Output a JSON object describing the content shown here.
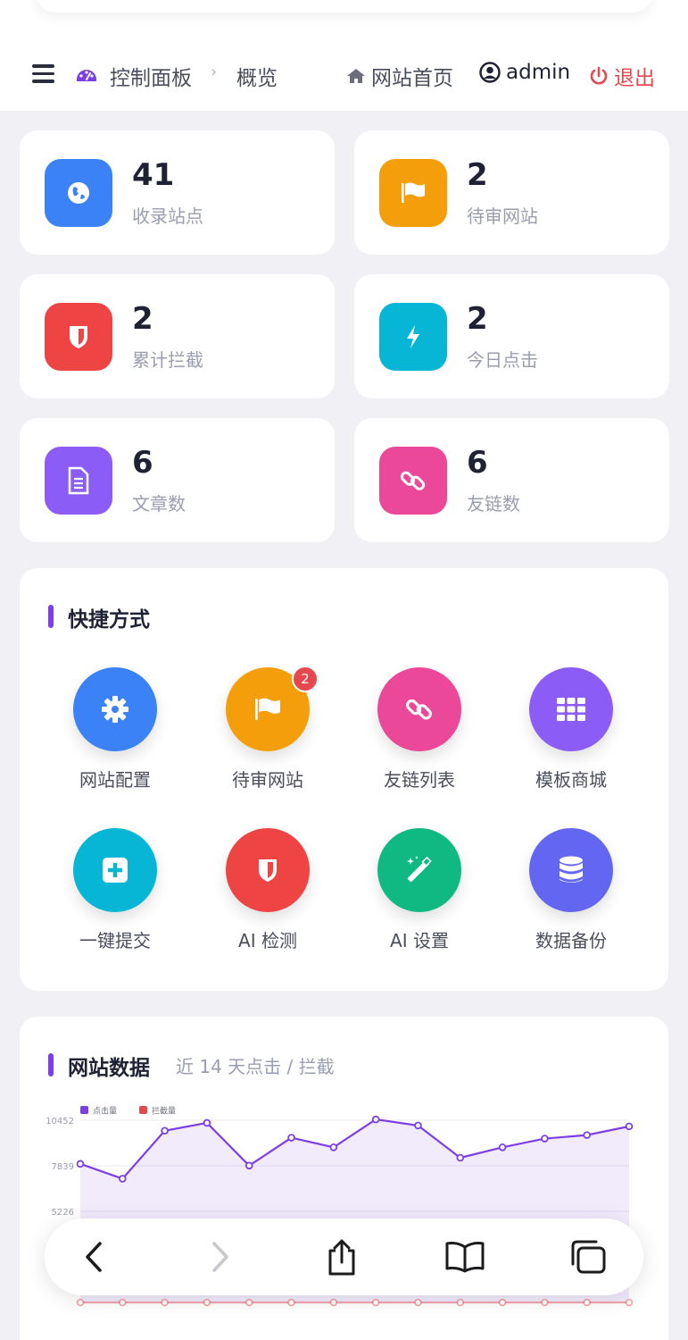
{
  "header": {
    "breadcrumb_title": "控制面板",
    "breadcrumb_sep": "›",
    "breadcrumb_current": "概览",
    "home_label": "网站首页",
    "user_label": "admin",
    "logout_label": "退出"
  },
  "stats": [
    {
      "value": "41",
      "label": "收录站点",
      "color": "#3b82f6",
      "icon": "globe-icon"
    },
    {
      "value": "2",
      "label": "待审网站",
      "color": "#f59e0b",
      "icon": "flag-icon"
    },
    {
      "value": "2",
      "label": "累计拦截",
      "color": "#ef4444",
      "icon": "shield-icon"
    },
    {
      "value": "2",
      "label": "今日点击",
      "color": "#06b6d4",
      "icon": "bolt-icon"
    },
    {
      "value": "6",
      "label": "文章数",
      "color": "#8b5cf6",
      "icon": "document-icon"
    },
    {
      "value": "6",
      "label": "友链数",
      "color": "#ec4899",
      "icon": "link-icon"
    }
  ],
  "shortcuts": {
    "title": "快捷方式",
    "items": [
      {
        "label": "网站配置",
        "color": "#3b82f6",
        "icon": "gear-icon"
      },
      {
        "label": "待审网站",
        "color": "#f59e0b",
        "icon": "flag-icon",
        "badge": "2"
      },
      {
        "label": "友链列表",
        "color": "#ec4899",
        "icon": "link-icon"
      },
      {
        "label": "模板商城",
        "color": "#8b5cf6",
        "icon": "grid-icon"
      },
      {
        "label": "一键提交",
        "color": "#06b6d4",
        "icon": "plus-icon"
      },
      {
        "label": "AI 检测",
        "color": "#ef4444",
        "icon": "shield-icon"
      },
      {
        "label": "AI 设置",
        "color": "#10b981",
        "icon": "magic-wand-icon"
      },
      {
        "label": "数据备份",
        "color": "#6366f1",
        "icon": "database-icon"
      }
    ]
  },
  "site_data": {
    "title": "网站数据",
    "subtitle": "近 14 天点击 / 拦截"
  },
  "chart_data": {
    "type": "line",
    "x": [
      "",
      "",
      "",
      "",
      "",
      "",
      "",
      "",
      "",
      "",
      "",
      "",
      "",
      ""
    ],
    "series": [
      {
        "name": "点击量",
        "color": "#7b3fe4",
        "values": [
          7950,
          7100,
          9850,
          10300,
          7850,
          9450,
          8900,
          10500,
          10150,
          8300,
          8900,
          9400,
          9600,
          10100
        ]
      },
      {
        "name": "拦截量",
        "color": "#e5484d",
        "values": [
          0,
          0,
          0,
          0,
          0,
          0,
          0,
          0,
          0,
          0,
          0,
          0,
          0,
          0
        ]
      }
    ],
    "yticks": [
      10452,
      7839,
      5226
    ],
    "ylim": [
      0,
      10452
    ],
    "area_fill": true
  }
}
